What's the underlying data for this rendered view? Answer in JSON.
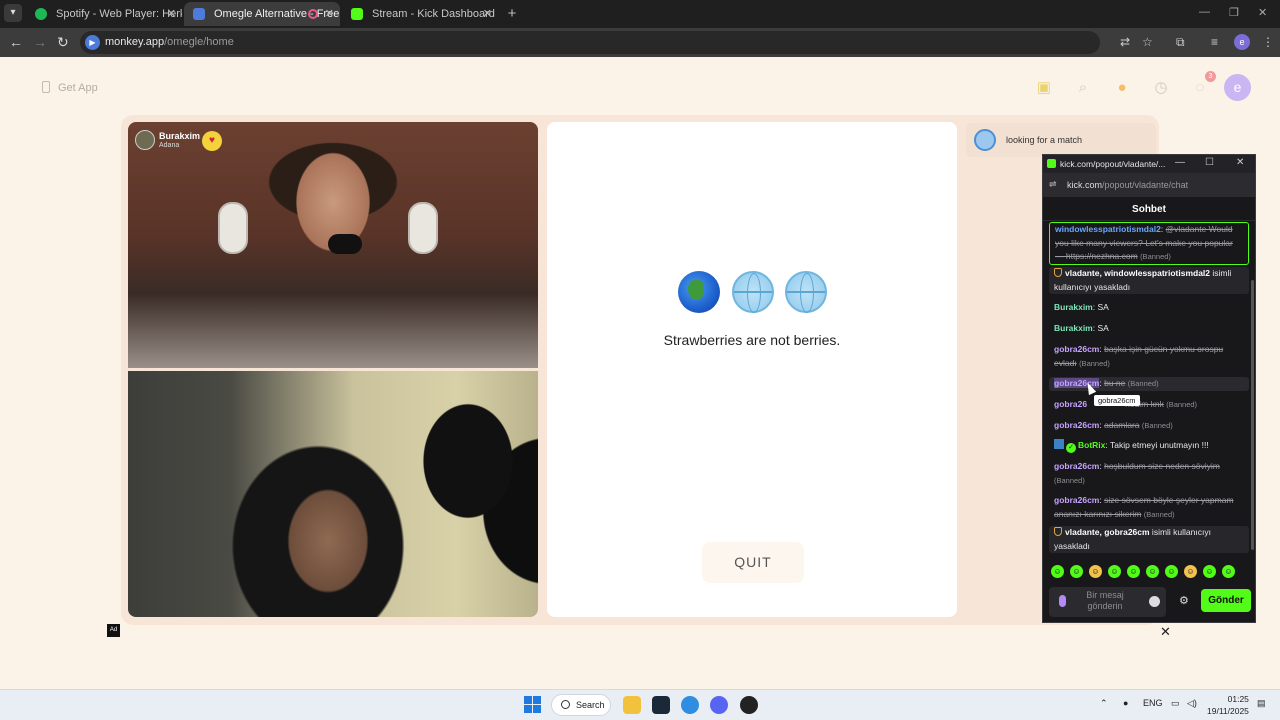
{
  "browser": {
    "tabs": [
      {
        "title": "Spotify - Web Player: Herkes iç",
        "active": false
      },
      {
        "title": "Omegle Alternative - Free &",
        "active": true
      },
      {
        "title": "Stream - Kick Dashboard",
        "active": false
      }
    ],
    "url_host": "monkey.app",
    "url_path": "/omegle/home"
  },
  "page": {
    "get_app": "Get App",
    "notification_count": "3",
    "profile_initial": "e",
    "peer": {
      "name": "Burakxim",
      "location": "Adana"
    },
    "fact": "Strawberries are not berries.",
    "quit_label": "QUIT",
    "match_status": "looking for a match",
    "ad_label": "Ad"
  },
  "popout": {
    "window_title": "kick.com/popout/vladante/...",
    "url_host": "kick.com",
    "url_path": "/popout/vladante/chat",
    "header": "Sohbet",
    "messages": {
      "m1": {
        "user": "windowlesspatriotismdal2",
        "sep": ": ",
        "text": "@vladante Would you like many viewers? Let's make you popular — https://nezhna.com",
        "status": "(Banned)"
      },
      "m2": {
        "users": "vladante, windowlesspatriotismdal2",
        "text": " isimli kullanıcıyı yasakladı"
      },
      "m3": {
        "user": "Burakxim",
        "sep": ": ",
        "text": "SA"
      },
      "m4": {
        "user": "Burakxim",
        "sep": ": ",
        "text": "SA"
      },
      "m5": {
        "user": "gobra26cm",
        "sep": ": ",
        "text": "başka işin gücün yokmu orospu evladı",
        "status": "(Banned)"
      },
      "m6": {
        "user": "gobra26cm",
        "sep": ": ",
        "text": "bu ne",
        "status": "(Banned)"
      },
      "m7": {
        "user": "gobra26",
        "sep": "",
        "text": "nedim knk",
        "status": "(Banned)"
      },
      "m8": {
        "user": "gobra26cm",
        "sep": ": ",
        "text": "adamlara",
        "status": "(Banned)"
      },
      "m9": {
        "user": "BotRix",
        "sep": ": ",
        "text": "Takip etmeyi unutmayın !!!"
      },
      "m10": {
        "user": "gobra26cm",
        "sep": ": ",
        "text": "hoşbuldum size neden söviyim",
        "status": "(Banned)"
      },
      "m11": {
        "user": "gobra26cm",
        "sep": ": ",
        "text": "size sövsem böyle şeyler yapmam ananızı karınızı sikerim",
        "status": "(Banned)"
      },
      "m12": {
        "users": "vladante, gobra26cm",
        "text": " isimli kullanıcıyı yasakladı"
      }
    },
    "tooltip": "gobra26cm",
    "input_placeholder": "Bir mesaj gönderin",
    "send_label": "Gönder"
  },
  "taskbar": {
    "search": "Search",
    "language": "ENG",
    "time": "01:25",
    "date": "19/11/2025"
  },
  "colors": {
    "kick_green": "#53fc18",
    "page_bg": "#fbf3e7",
    "chat_bg": "#18181b"
  }
}
